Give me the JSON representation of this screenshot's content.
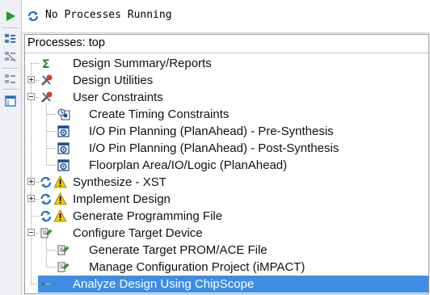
{
  "status": {
    "text": "No Processes Running",
    "icon": "refresh-icon"
  },
  "toolbar": {
    "buttons": [
      {
        "name": "run-icon"
      },
      {
        "name": "rerun-icon"
      },
      {
        "name": "rerun-all-icon"
      },
      {
        "name": "stop-icon"
      },
      {
        "name": "properties-icon"
      }
    ]
  },
  "panel": {
    "title": "Processes: top",
    "items": [
      {
        "label": "Design Summary/Reports",
        "level": 0,
        "expander": "none",
        "icons": [
          "sigma-icon"
        ]
      },
      {
        "label": "Design Utilities",
        "level": 0,
        "expander": "plus",
        "icons": [
          "tools-icon"
        ]
      },
      {
        "label": "User Constraints",
        "level": 0,
        "expander": "minus",
        "icons": [
          "tools-icon"
        ]
      },
      {
        "label": "Create Timing Constraints",
        "level": 1,
        "expander": "none",
        "icons": [
          "timing-icon"
        ]
      },
      {
        "label": "I/O Pin Planning (PlanAhead) - Pre-Synthesis",
        "level": 1,
        "expander": "none",
        "icons": [
          "planahead-icon"
        ]
      },
      {
        "label": "I/O Pin Planning (PlanAhead) - Post-Synthesis",
        "level": 1,
        "expander": "none",
        "icons": [
          "planahead-icon"
        ]
      },
      {
        "label": "Floorplan Area/IO/Logic (PlanAhead)",
        "level": 1,
        "expander": "none",
        "icons": [
          "planahead-icon"
        ]
      },
      {
        "label": "Synthesize - XST",
        "level": 0,
        "expander": "plus",
        "icons": [
          "refresh-icon",
          "warning-icon"
        ]
      },
      {
        "label": "Implement Design",
        "level": 0,
        "expander": "plus",
        "icons": [
          "refresh-icon",
          "warning-icon"
        ]
      },
      {
        "label": "Generate Programming File",
        "level": 0,
        "expander": "none",
        "icons": [
          "refresh-icon",
          "warning-icon"
        ]
      },
      {
        "label": "Configure Target Device",
        "level": 0,
        "expander": "minus",
        "icons": [
          "device-icon"
        ]
      },
      {
        "label": "Generate Target PROM/ACE File",
        "level": 1,
        "expander": "none",
        "icons": [
          "device-icon"
        ]
      },
      {
        "label": "Manage Configuration Project (iMPACT)",
        "level": 1,
        "expander": "none",
        "icons": [
          "device-icon"
        ]
      },
      {
        "label": "Analyze Design Using ChipScope",
        "level": 0,
        "expander": "none",
        "icons": [
          "chipscope-icon"
        ],
        "selected": true
      }
    ]
  },
  "colors": {
    "selection": "#3c8de3",
    "warning": "#f5c400",
    "refresh": "#1a6fc9",
    "run": "#1aa31a"
  }
}
